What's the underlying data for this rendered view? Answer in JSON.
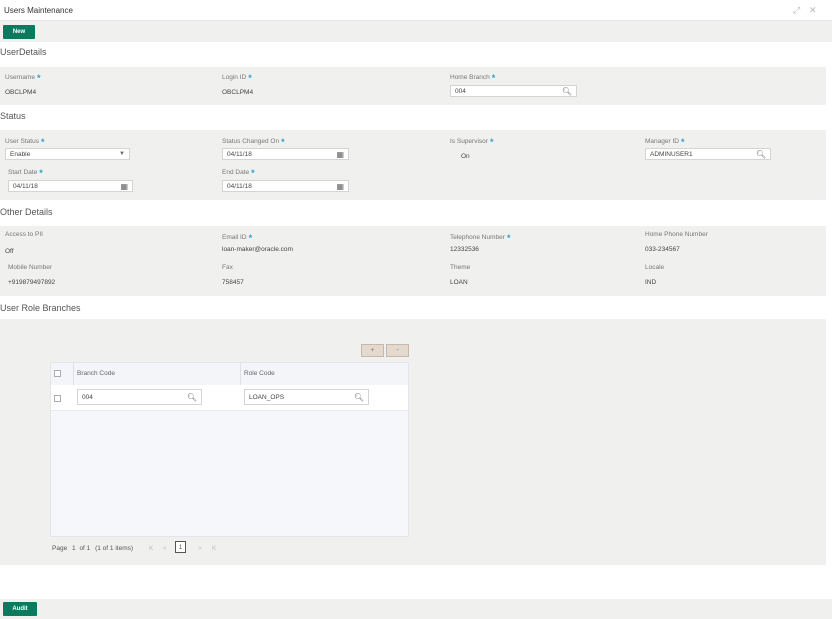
{
  "window": {
    "title": "Users Maintenance",
    "maximize_icon": "expand-icon",
    "close_icon": "close-icon"
  },
  "toolbar": {
    "new_label": "New"
  },
  "sections": {
    "user_details": "UserDetails",
    "status": "Status",
    "other_details": "Other Details",
    "user_role_branches": "User Role Branches"
  },
  "user_details": {
    "username": {
      "label": "Username",
      "value": "OBCLPM4"
    },
    "login_id": {
      "label": "Login ID",
      "value": "OBCLPM4"
    },
    "home_branch": {
      "label": "Home Branch",
      "value": "004"
    }
  },
  "status": {
    "user_status": {
      "label": "User Status",
      "value": "Enable"
    },
    "status_changed_on": {
      "label": "Status Changed On",
      "value": "04/11/18"
    },
    "is_supervisor": {
      "label": "Is Supervisor",
      "value": "On"
    },
    "manager_id": {
      "label": "Manager ID",
      "value": "ADMINUSER1"
    },
    "start_date": {
      "label": "Start Date",
      "value": "04/11/18"
    },
    "end_date": {
      "label": "End Date",
      "value": "04/11/18"
    }
  },
  "other_details": {
    "access_to_pii": {
      "label": "Access to PII",
      "value": "Off"
    },
    "email_id": {
      "label": "Email ID",
      "value": "loan-maker@oracle.com"
    },
    "telephone_number": {
      "label": "Telephone Number",
      "value": "12332536"
    },
    "home_phone_number": {
      "label": "Home Phone Number",
      "value": "033-234567"
    },
    "mobile_number": {
      "label": "Mobile Number",
      "value": "+919879497892"
    },
    "fax": {
      "label": "Fax",
      "value": "758457"
    },
    "theme": {
      "label": "Theme",
      "value": "LOAN"
    },
    "locale": {
      "label": "Locale",
      "value": "IND"
    }
  },
  "role_grid": {
    "add_label": "+",
    "remove_label": "-",
    "columns": [
      "Branch Code",
      "Role Code"
    ],
    "rows": [
      {
        "branch_code": "004",
        "role_code": "LOAN_OPS"
      }
    ],
    "pager": {
      "page_label": "Page",
      "page": "1",
      "of_label": "of 1",
      "summary": "(1 of 1 items)",
      "first": "K",
      "prev": "<",
      "current": "1",
      "next": ">",
      "last": "K"
    }
  },
  "footer": {
    "audit_label": "Audit"
  },
  "colors": {
    "accent": "#0b7a5f",
    "required": "#2aa3c9",
    "panel": "#f0f0ef"
  }
}
